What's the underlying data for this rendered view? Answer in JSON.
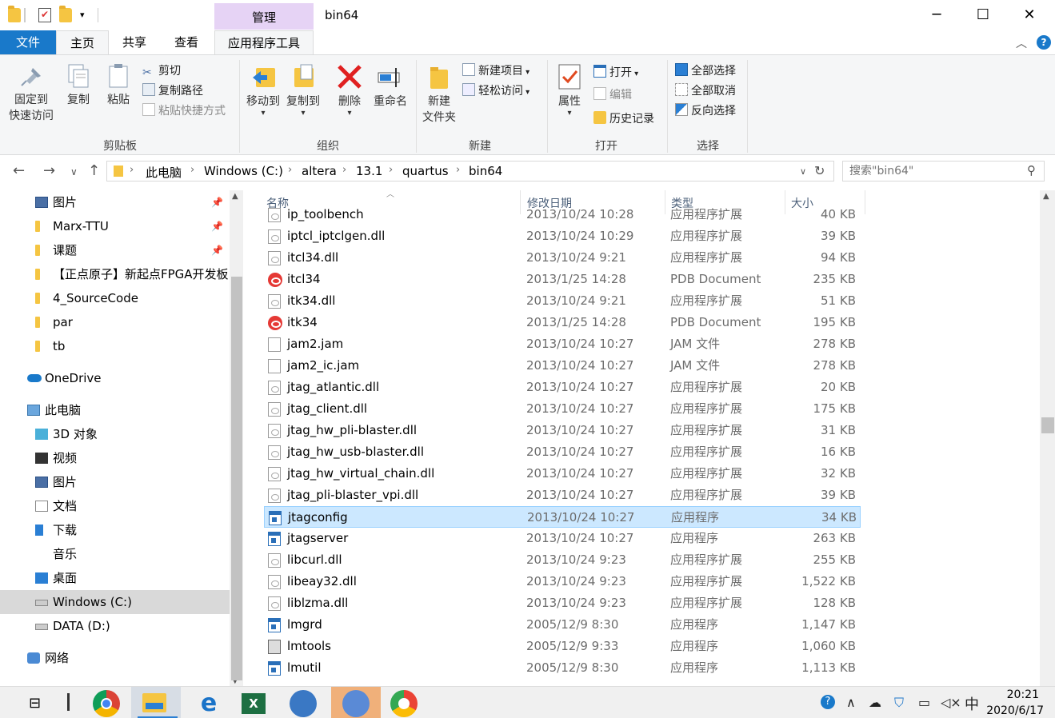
{
  "window": {
    "title": "bin64",
    "context_tab": "管理",
    "minimize": "─",
    "maximize": "☐",
    "close": "✕"
  },
  "tabs": {
    "file": "文件",
    "home": "主页",
    "share": "共享",
    "view": "查看",
    "app_tools": "应用程序工具"
  },
  "ribbon": {
    "clipboard": {
      "label": "剪贴板",
      "pin_quick_access": [
        "固定到",
        "快速访问"
      ],
      "copy": "复制",
      "paste": "粘贴",
      "cut": "剪切",
      "copy_path": "复制路径",
      "paste_shortcut": "粘贴快捷方式"
    },
    "organize": {
      "label": "组织",
      "move_to": "移动到",
      "copy_to": "复制到",
      "delete": "删除",
      "rename": "重命名"
    },
    "new": {
      "label": "新建",
      "new_folder": [
        "新建",
        "文件夹"
      ],
      "new_item": "新建项目",
      "easy_access": "轻松访问"
    },
    "open": {
      "label": "打开",
      "properties": "属性",
      "open": "打开",
      "edit": "编辑",
      "history": "历史记录"
    },
    "select": {
      "label": "选择",
      "select_all": "全部选择",
      "select_none": "全部取消",
      "invert": "反向选择"
    }
  },
  "address": {
    "crumbs": [
      "此电脑",
      "Windows (C:)",
      "altera",
      "13.1",
      "quartus",
      "bin64"
    ],
    "search_placeholder": "搜索\"bin64\""
  },
  "nav": {
    "quick": [
      {
        "label": "图片",
        "pinned": true
      },
      {
        "label": "Marx-TTU",
        "pinned": true
      },
      {
        "label": "课题",
        "pinned": true
      },
      {
        "label": "【正点原子】新起点FPGA开发板"
      },
      {
        "label": "4_SourceCode"
      },
      {
        "label": "par"
      },
      {
        "label": "tb"
      }
    ],
    "onedrive": "OneDrive",
    "this_pc": "此电脑",
    "pc_items": [
      "3D 对象",
      "视频",
      "图片",
      "文档",
      "下载",
      "音乐",
      "桌面",
      "Windows (C:)",
      "DATA (D:)"
    ],
    "network": "网络"
  },
  "columns": {
    "name": "名称",
    "date": "修改日期",
    "type": "类型",
    "size": "大小"
  },
  "files": [
    {
      "name": "ip_toolbench",
      "date": "2013/10/24 10:28",
      "type": "应用程序扩展",
      "size": "40 KB",
      "icon": "dll"
    },
    {
      "name": "iptcl_iptclgen.dll",
      "date": "2013/10/24 10:29",
      "type": "应用程序扩展",
      "size": "39 KB",
      "icon": "dll"
    },
    {
      "name": "itcl34.dll",
      "date": "2013/10/24 9:21",
      "type": "应用程序扩展",
      "size": "94 KB",
      "icon": "dll"
    },
    {
      "name": "itcl34",
      "date": "2013/1/25 14:28",
      "type": "PDB Document",
      "size": "235 KB",
      "icon": "pdb"
    },
    {
      "name": "itk34.dll",
      "date": "2013/10/24 9:21",
      "type": "应用程序扩展",
      "size": "51 KB",
      "icon": "dll"
    },
    {
      "name": "itk34",
      "date": "2013/1/25 14:28",
      "type": "PDB Document",
      "size": "195 KB",
      "icon": "pdb"
    },
    {
      "name": "jam2.jam",
      "date": "2013/10/24 10:27",
      "type": "JAM 文件",
      "size": "278 KB",
      "icon": "jam"
    },
    {
      "name": "jam2_ic.jam",
      "date": "2013/10/24 10:27",
      "type": "JAM 文件",
      "size": "278 KB",
      "icon": "jam"
    },
    {
      "name": "jtag_atlantic.dll",
      "date": "2013/10/24 10:27",
      "type": "应用程序扩展",
      "size": "20 KB",
      "icon": "dll"
    },
    {
      "name": "jtag_client.dll",
      "date": "2013/10/24 10:27",
      "type": "应用程序扩展",
      "size": "175 KB",
      "icon": "dll"
    },
    {
      "name": "jtag_hw_pli-blaster.dll",
      "date": "2013/10/24 10:27",
      "type": "应用程序扩展",
      "size": "31 KB",
      "icon": "dll"
    },
    {
      "name": "jtag_hw_usb-blaster.dll",
      "date": "2013/10/24 10:27",
      "type": "应用程序扩展",
      "size": "16 KB",
      "icon": "dll"
    },
    {
      "name": "jtag_hw_virtual_chain.dll",
      "date": "2013/10/24 10:27",
      "type": "应用程序扩展",
      "size": "32 KB",
      "icon": "dll"
    },
    {
      "name": "jtag_pli-blaster_vpi.dll",
      "date": "2013/10/24 10:27",
      "type": "应用程序扩展",
      "size": "39 KB",
      "icon": "dll"
    },
    {
      "name": "jtagconfig",
      "date": "2013/10/24 10:27",
      "type": "应用程序",
      "size": "34 KB",
      "icon": "exe",
      "selected": true
    },
    {
      "name": "jtagserver",
      "date": "2013/10/24 10:27",
      "type": "应用程序",
      "size": "263 KB",
      "icon": "exe"
    },
    {
      "name": "libcurl.dll",
      "date": "2013/10/24 9:23",
      "type": "应用程序扩展",
      "size": "255 KB",
      "icon": "dll"
    },
    {
      "name": "libeay32.dll",
      "date": "2013/10/24 9:23",
      "type": "应用程序扩展",
      "size": "1,522 KB",
      "icon": "dll"
    },
    {
      "name": "liblzma.dll",
      "date": "2013/10/24 9:23",
      "type": "应用程序扩展",
      "size": "128 KB",
      "icon": "dll"
    },
    {
      "name": "lmgrd",
      "date": "2005/12/9 8:30",
      "type": "应用程序",
      "size": "1,147 KB",
      "icon": "exe"
    },
    {
      "name": "lmtools",
      "date": "2005/12/9 9:33",
      "type": "应用程序",
      "size": "1,060 KB",
      "icon": "tool"
    },
    {
      "name": "lmutil",
      "date": "2005/12/9 8:30",
      "type": "应用程序",
      "size": "1,113 KB",
      "icon": "exe"
    }
  ],
  "taskbar": {
    "time": "20:21",
    "date": "2020/6/17",
    "ime": "中"
  }
}
